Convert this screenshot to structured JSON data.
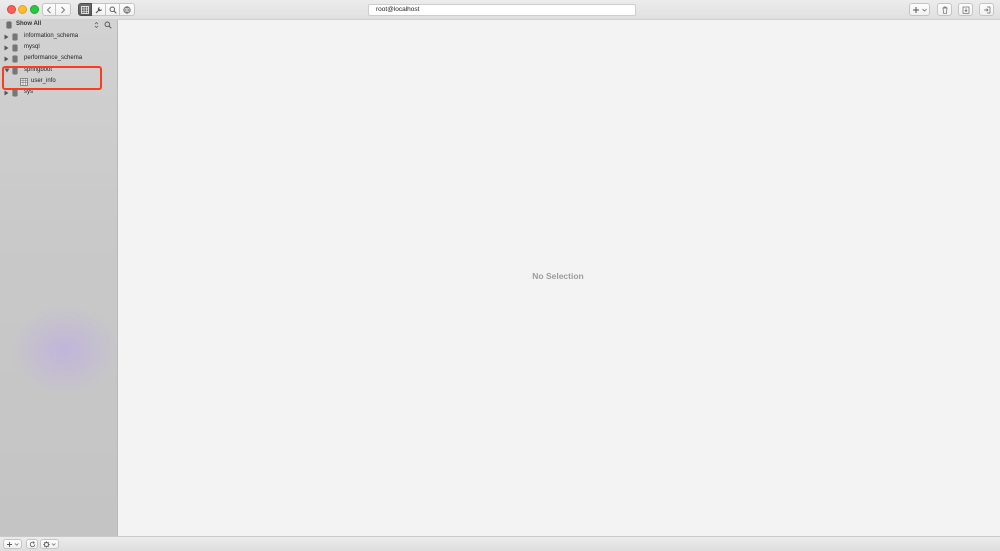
{
  "window": {
    "connection_title": "root@localhost",
    "icons": {
      "traffic_lights": [
        "close",
        "minimize",
        "zoom"
      ],
      "nav": [
        "back-arrow-icon",
        "forward-arrow-icon"
      ],
      "toolbar": [
        "table-grid-icon",
        "wrench-icon",
        "magnifier-icon",
        "globe-icon"
      ],
      "right_toolbar": [
        "plus-icon",
        "chevron-down-icon",
        "trash-icon",
        "export-icon",
        "disconnect-icon"
      ]
    }
  },
  "sidebar": {
    "header_label": "Show All",
    "databases": [
      {
        "name": "information_schema",
        "expanded": false
      },
      {
        "name": "mysql",
        "expanded": false
      },
      {
        "name": "performance_schema",
        "expanded": false
      },
      {
        "name": "springboot",
        "expanded": true,
        "tables": [
          "user_info"
        ]
      },
      {
        "name": "sys",
        "expanded": false
      }
    ],
    "highlight_color": "#ff3b1e"
  },
  "main": {
    "empty_state": "No Selection"
  },
  "colors": {
    "close": "#fe5f57",
    "minimize": "#febc2e",
    "zoom": "#28c840",
    "active_toolbar": "#5a5a5a"
  }
}
